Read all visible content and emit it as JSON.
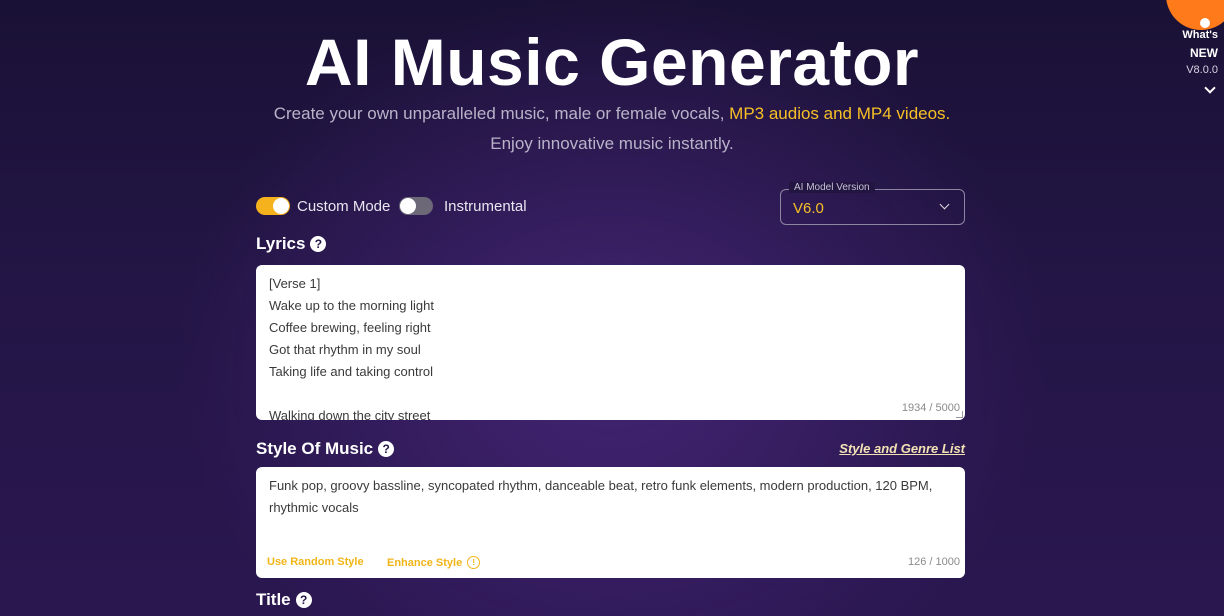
{
  "header": {
    "title": "AI Music Generator",
    "subtitle_plain": "Create your own unparalleled music, male or female vocals, ",
    "subtitle_highlight": "MP3 audios and MP4 videos.",
    "subtitle_line2": "Enjoy innovative music instantly."
  },
  "whats_new": {
    "line1": "What's",
    "line2": "NEW",
    "version": "V8.0.0"
  },
  "toggles": {
    "custom_mode": {
      "label": "Custom Mode",
      "on": true
    },
    "instrumental": {
      "label": "Instrumental",
      "on": false
    }
  },
  "model": {
    "legend": "AI Model Version",
    "value": "V6.0"
  },
  "lyrics": {
    "label": "Lyrics",
    "lines": [
      "[Verse 1]",
      "Wake up to the morning light",
      "Coffee brewing, feeling right",
      "Got that rhythm in my soul",
      "Taking life and taking control",
      "",
      "Walking down the city street"
    ],
    "counter": "1934 / 5000"
  },
  "style": {
    "label": "Style Of Music",
    "genre_link": "Style and Genre List",
    "text": "Funk pop, groovy bassline, syncopated rhythm, danceable beat, retro funk elements, modern production, 120 BPM, rhythmic vocals",
    "random_label": "Use Random Style",
    "enhance_label": "Enhance Style",
    "counter": "126 / 1000"
  },
  "title_section": {
    "label": "Title"
  },
  "colors": {
    "accent": "#f6c026",
    "background": "#231545",
    "toggle_on": "#f5b21c"
  }
}
